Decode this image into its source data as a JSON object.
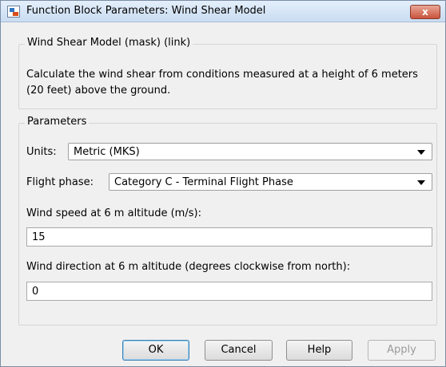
{
  "window": {
    "title": "Function Block Parameters: Wind Shear Model",
    "close_label": "x"
  },
  "mask": {
    "heading": "Wind Shear Model (mask) (link)",
    "description": "Calculate the wind shear from conditions measured at a height of 6 meters (20 feet) above the ground."
  },
  "parameters": {
    "heading": "Parameters",
    "units_label": "Units:",
    "units_value": "Metric (MKS)",
    "flight_phase_label": "Flight phase:",
    "flight_phase_value": "Category C - Terminal Flight Phase",
    "wind_speed_label": "Wind speed at 6 m altitude (m/s):",
    "wind_speed_value": "15",
    "wind_direction_label": "Wind direction at 6 m altitude (degrees clockwise from north):",
    "wind_direction_value": "0"
  },
  "buttons": {
    "ok": "OK",
    "cancel": "Cancel",
    "help": "Help",
    "apply": "Apply"
  }
}
